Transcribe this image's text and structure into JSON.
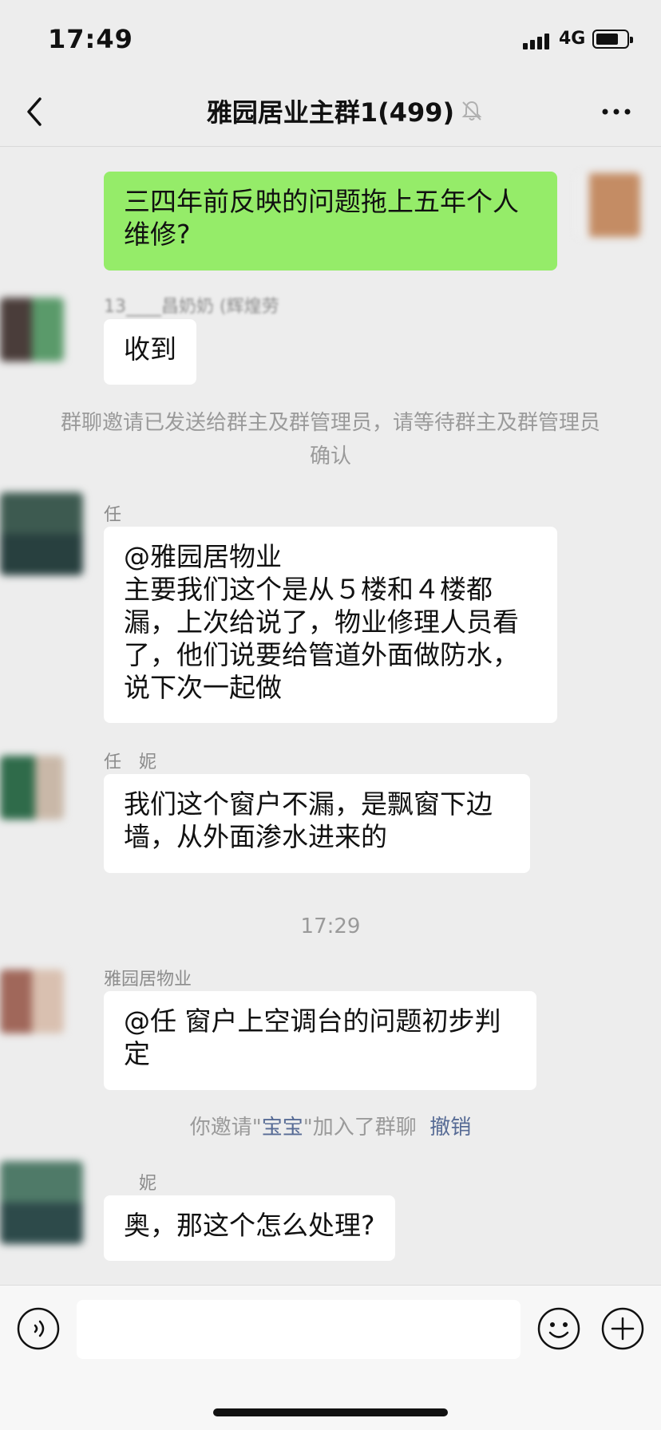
{
  "status_bar": {
    "time": "17:49",
    "network": "4G",
    "battery_level": 0.75
  },
  "nav": {
    "title": "雅园居业主群1(499)"
  },
  "messages": [
    {
      "type": "sent",
      "text": "三四年前反映的问题拖上五年个人\n维修?"
    },
    {
      "type": "received",
      "sender": "13____昌奶奶 (辉煌劳",
      "text": "收到"
    },
    {
      "type": "system",
      "text": "群聊邀请已发送给群主及群管理员，请等待群主及群管理员确认"
    },
    {
      "type": "received",
      "sender": "任",
      "text": "@雅园居物业\n主要我们这个是从５楼和４楼都\n漏，上次给说了，物业修理人员看\n了，他们说要给管道外面做防水，\n说下次一起做"
    },
    {
      "type": "received",
      "sender": "任　妮",
      "text": "我们这个窗户不漏，是飘窗下边\n墙，从外面渗水进来的"
    },
    {
      "type": "time",
      "text": "17:29"
    },
    {
      "type": "received",
      "sender": "雅园居物业",
      "text": "@任 窗户上空调台的问题初步判\n定"
    },
    {
      "type": "system_invite",
      "prefix": "你邀请\"",
      "name": "宝宝",
      "suffix": "\"加入了群聊",
      "action": "撤销"
    },
    {
      "type": "received",
      "sender": "　　妮",
      "text": "奥，那这个怎么处理?"
    }
  ],
  "input": {
    "placeholder": ""
  }
}
